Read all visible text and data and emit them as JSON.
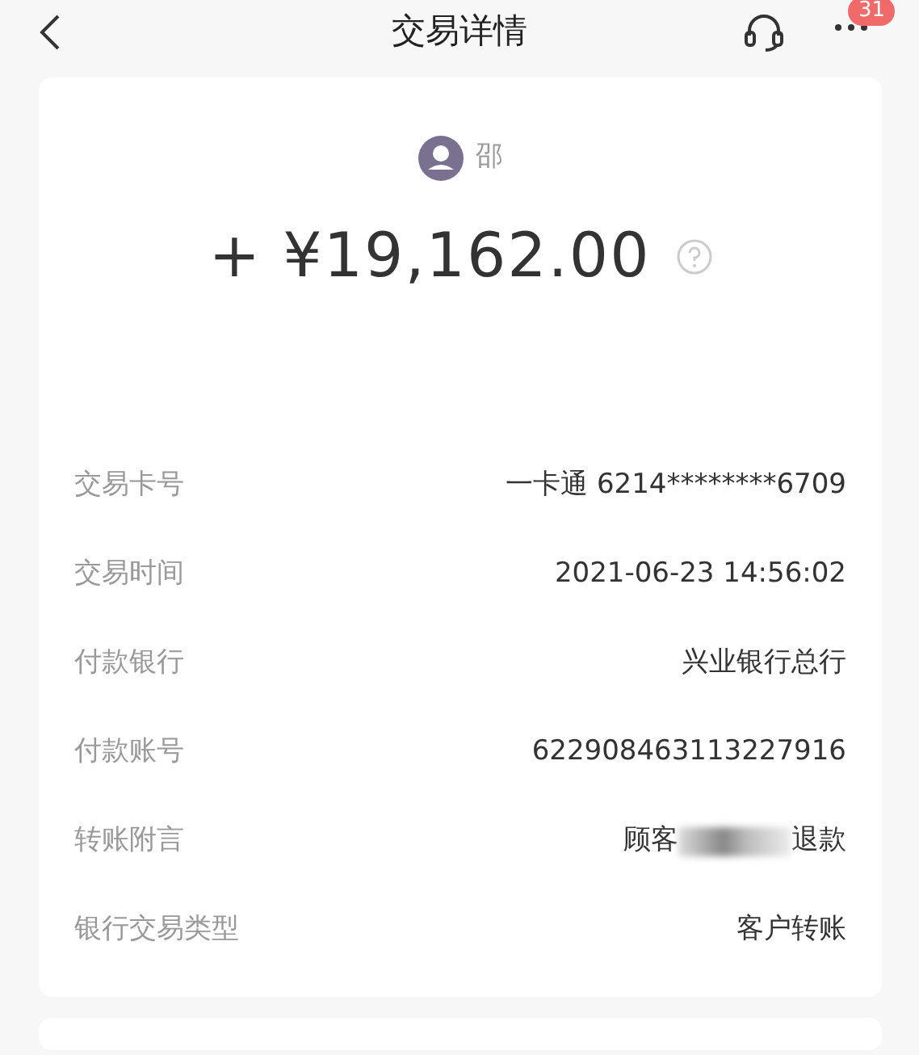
{
  "header": {
    "title": "交易详情",
    "badge": "31"
  },
  "payer": {
    "name": "邵"
  },
  "amount": "+ ¥19,162.00",
  "details": [
    {
      "kind": "text",
      "label": "交易卡号",
      "value": "一卡通 6214********6709"
    },
    {
      "kind": "text",
      "label": "交易时间",
      "value": "2021-06-23 14:56:02"
    },
    {
      "kind": "text",
      "label": "付款银行",
      "value": "兴业银行总行"
    },
    {
      "kind": "text",
      "label": "付款账号",
      "value": "622908463113227916"
    },
    {
      "kind": "redacted",
      "label": "转账附言",
      "before": "顾客",
      "after": "退款"
    },
    {
      "kind": "text",
      "label": "银行交易类型",
      "value": "客户转账"
    }
  ]
}
